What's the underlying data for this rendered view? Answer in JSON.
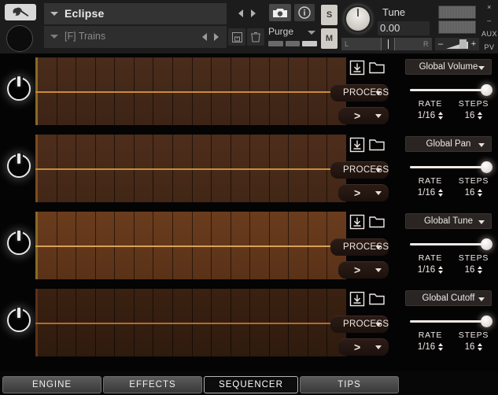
{
  "header": {
    "wrench_icon": "wrench-icon",
    "instrument_name": "Eclipse",
    "preset_name": "[F] Trains",
    "camera_icon": "camera-icon",
    "info_icon": "info-icon",
    "save_icon": "floppy-disk-icon",
    "delete_icon": "trash-icon",
    "purge_label": "Purge",
    "solo_label": "S",
    "mute_label": "M",
    "tune_label": "Tune",
    "tune_value": "0.00",
    "pan_left_label": "L",
    "pan_right_label": "R",
    "volume_minus": "–",
    "volume_plus": "+",
    "rail": [
      "×",
      "–",
      "AUX",
      "PV"
    ]
  },
  "sequencer": {
    "step_count": 16,
    "icons": {
      "download": "download-icon",
      "folder": "folder-icon"
    },
    "process_label": "PROCESS",
    "play_label": ">",
    "rate_title": "RATE",
    "steps_title": "STEPS",
    "rows": [
      {
        "power_on": true,
        "target": "Global Volume",
        "rate": "1/16",
        "steps": "16",
        "slider_pct": 93,
        "grid_color_top": "#4a2c1b",
        "grid_color_bottom": "#3d2416",
        "grid_line": "#c98c3c",
        "left_bar": "#8a6a22"
      },
      {
        "power_on": true,
        "target": "Global Pan",
        "rate": "1/16",
        "steps": "16",
        "slider_pct": 93,
        "grid_color_top": "#4e2d1b",
        "grid_color_bottom": "#422716",
        "grid_line": "#c98c3c",
        "left_bar": "#7e4a1e"
      },
      {
        "power_on": true,
        "target": "Global Tune",
        "rate": "1/16",
        "steps": "16",
        "slider_pct": 93,
        "grid_color_top": "#6a3c1d",
        "grid_color_bottom": "#5a3218",
        "grid_line": "#d9a055",
        "left_bar": "#8a6a22"
      },
      {
        "power_on": true,
        "target": "Global Cutoff",
        "rate": "1/16",
        "steps": "16",
        "slider_pct": 93,
        "grid_color_top": "#3a2111",
        "grid_color_bottom": "#2f1b0e",
        "grid_line": "#b5692a",
        "left_bar": "#5d3116"
      }
    ]
  },
  "tabs": [
    {
      "label": "ENGINE",
      "active": false
    },
    {
      "label": "EFFECTS",
      "active": false
    },
    {
      "label": "SEQUENCER",
      "active": true
    },
    {
      "label": "TIPS",
      "active": false
    }
  ],
  "colors": {
    "accent_amber": "#c98c3c",
    "panel_dark": "#1c1c1c",
    "background": "#050404"
  }
}
